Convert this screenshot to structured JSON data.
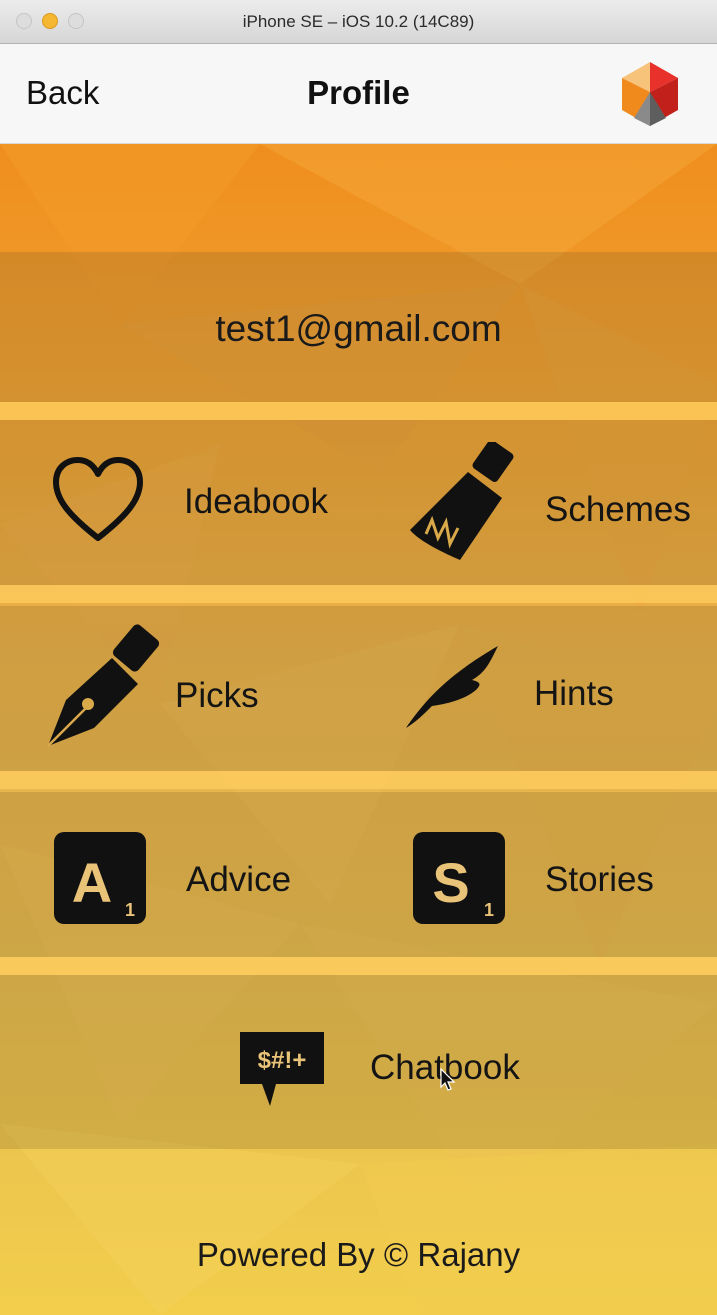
{
  "window": {
    "title": "iPhone SE – iOS 10.2 (14C89)"
  },
  "navbar": {
    "back_label": "Back",
    "title": "Profile",
    "logo_icon": "cube-logo-icon"
  },
  "profile": {
    "email": "test1@gmail.com"
  },
  "menu": [
    {
      "label": "Ideabook",
      "icon": "heart-icon"
    },
    {
      "label": "Schemes",
      "icon": "paintbrush-icon"
    },
    {
      "label": "Picks",
      "icon": "fountain-pen-icon"
    },
    {
      "label": "Hints",
      "icon": "feather-icon"
    },
    {
      "label": "Advice",
      "icon": "letter-tile-a-icon",
      "tile_letter": "A",
      "tile_score": "1"
    },
    {
      "label": "Stories",
      "icon": "letter-tile-s-icon",
      "tile_letter": "S",
      "tile_score": "1"
    },
    {
      "label": "Chatbook",
      "icon": "speech-bubble-icon",
      "bubble_text": "$#!+"
    }
  ],
  "footer": {
    "text": "Powered By © Rajany"
  },
  "colors": {
    "accent": "#f0a232",
    "band_overlay": "#785a28",
    "stripe": "#ffcd5f",
    "logo_red": "#e8312a",
    "logo_orange": "#f08a1d"
  }
}
